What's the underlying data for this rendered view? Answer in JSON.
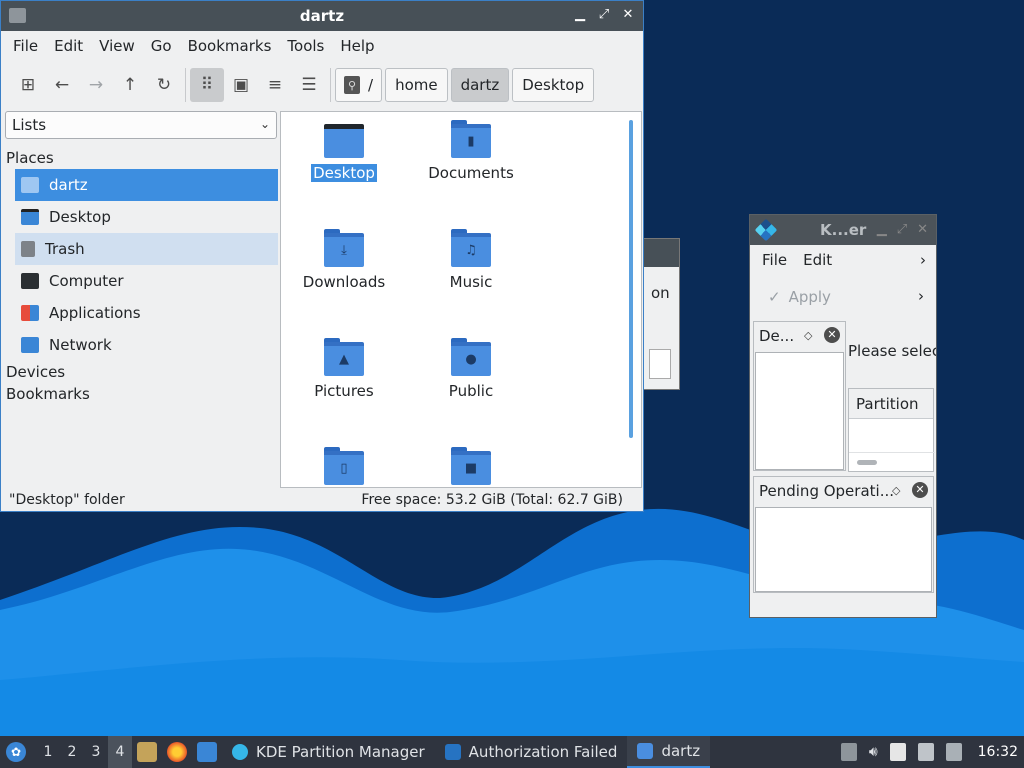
{
  "file_manager": {
    "title": "dartz",
    "menu": [
      "File",
      "Edit",
      "View",
      "Go",
      "Bookmarks",
      "Tools",
      "Help"
    ],
    "breadcrumbs": [
      "/",
      "home",
      "dartz",
      "Desktop"
    ],
    "side_mode": "Lists",
    "places_heading": "Places",
    "places": [
      "dartz",
      "Desktop",
      "Trash",
      "Computer",
      "Applications",
      "Network"
    ],
    "devices_heading": "Devices",
    "bookmarks_heading": "Bookmarks",
    "files": [
      "Desktop",
      "Documents",
      "Downloads",
      "Music",
      "Pictures",
      "Public",
      "",
      ""
    ],
    "status_left": "\"Desktop\" folder",
    "status_right": "Free space: 53.2 GiB (Total: 62.7 GiB)"
  },
  "auth_dialog": {
    "text_fragment": "on"
  },
  "partition_manager": {
    "title": "K...er",
    "menu": [
      "File",
      "Edit"
    ],
    "apply_label": "Apply",
    "devices_dock_title": "De...",
    "hint_text": "Please select",
    "table_header": "Partition",
    "pending_dock_title": "Pending Operati..."
  },
  "taskbar": {
    "workspaces": [
      "1",
      "2",
      "3",
      "4"
    ],
    "tasks": [
      "KDE Partition Manager",
      "Authorization Failed",
      "dartz"
    ],
    "clock": "16:32"
  },
  "colors": {
    "accent": "#3d8ee0",
    "folder": "#4a8ee0",
    "titlebar": "#475057",
    "taskbar": "#2f343f",
    "desktop_dark": "#0b2a55",
    "wave": "#1e90ea"
  }
}
